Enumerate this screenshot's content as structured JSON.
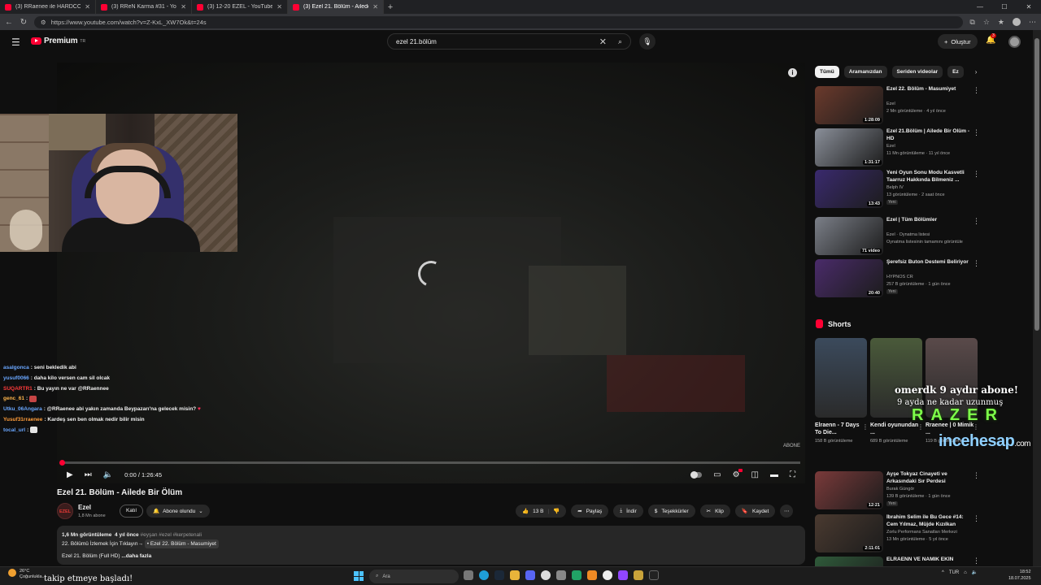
{
  "browser": {
    "tabs": [
      {
        "label": "(3) RRaenee ile HARDCORE MİNE"
      },
      {
        "label": "(3) RReN Karma #31 - YouTube"
      },
      {
        "label": "(3) 12-20 EZEL - YouTube"
      },
      {
        "label": "(3) Ezel 21. Bölüm - Ailede Bir Ölüm"
      }
    ],
    "url": "https://www.youtube.com/watch?v=Z-KxL_XW7Ok&t=24s"
  },
  "header": {
    "brand": "Premium",
    "brand_sup": "TR",
    "search_value": "ezel 21.bölüm",
    "create_label": "Oluştur",
    "notif_count": "3"
  },
  "player": {
    "time": "0:00 / 1:26:45",
    "watermark": "ABONE"
  },
  "chat": [
    {
      "user": "asalgonca",
      "color": "#6aa7ff",
      "msg": "seni bekledik abi"
    },
    {
      "user": "yusuf0066",
      "color": "#6aa7ff",
      "msg": "daha kilo versen cam sil olcak"
    },
    {
      "user": "SUQARTR1",
      "color": "#ff3b3b",
      "msg": "Bu yayın ne var @RRaennee"
    },
    {
      "user": "genc_61",
      "color": "#ffb64c",
      "msg": ""
    },
    {
      "user": "Utku_06Angara",
      "color": "#6aa7ff",
      "msg": "@RRaenee abi yakın zamanda Beypazarı'na gelecek misin?"
    },
    {
      "user": "Yusuf31rraenee",
      "color": "#ff9d3b",
      "msg": "Kardeş sen ben olmak nedir bilir misin"
    },
    {
      "user": "tocal_url",
      "color": "#6aa7ff",
      "msg": ""
    }
  ],
  "video": {
    "title": "Ezel 21. Bölüm - Ailede Bir Ölüm",
    "channel": "Ezel",
    "channel_avatar": "EZEL",
    "subscribers": "1,8 Mn abone",
    "join_label": "Katıl",
    "subscribed_label": "Abone olundu",
    "likes": "13 B",
    "share_label": "Paylaş",
    "download_label": "İndir",
    "thanks_label": "Teşekkürler",
    "clip_label": "Klip",
    "save_label": "Kaydet",
    "views": "1,6 Mn görüntüleme",
    "age": "4 yıl önce",
    "tags": "#eyşan #ezel #kerpetenali",
    "desc_line": "22. Bölümü İzlemek İçin Tıklayın→",
    "desc_link": "• Ezel 22. Bölüm - Masumiyet",
    "desc_tail": "Ezel 21. Bölüm (Full HD)",
    "more_label": "...daha fazla"
  },
  "sidebar": {
    "chips": [
      "Tümü",
      "Aramanızdan",
      "Seriden videolar",
      "Ez"
    ],
    "recommendations": [
      {
        "title": "Ezel 22. Bölüm - Masumiyet",
        "channel": "Ezel",
        "meta": "2 Mn görüntüleme · 4 yıl önce",
        "duration": "1:28:09",
        "badge": "",
        "thumb": "#6b3a2c"
      },
      {
        "title": "Ezel 21.Bölüm | Ailede Bir Ölüm - HD",
        "channel": "Ezel",
        "meta": "11 Mn görüntüleme · 11 yıl önce",
        "duration": "1:31:17",
        "badge": "",
        "thumb": "#8a8f99"
      },
      {
        "title": "Yeni Oyun Sonu Modu Kasvetli Taarruz Hakkında Bilmeniz ...",
        "channel": "Belph IV",
        "meta": "13 görüntüleme · 2 saat önce",
        "duration": "13:43",
        "badge": "Yeni",
        "thumb": "#3a2a6e"
      },
      {
        "title": "Ezel | Tüm Bölümler",
        "channel": "Ezel · Oynatma listesi",
        "meta": "Oynatma listesinin tamamını görüntüle",
        "duration": "71 video",
        "badge": "",
        "thumb": "#7b7f88"
      },
      {
        "title": "Şerefsiz Buton Destemi Beliriyor",
        "channel": "HYPNOS CR",
        "meta": "257 B görüntüleme · 1 gün önce",
        "duration": "20:40",
        "badge": "Yeni",
        "thumb": "#4a2b6a"
      }
    ],
    "shorts_title": "Shorts",
    "shorts": [
      {
        "title": "Elraenn - 7 Days To Die...",
        "views": "158 B görüntüleme",
        "thumb": "#3b4a5c"
      },
      {
        "title": "Kendi oyunundan ...",
        "views": "689 B görüntüleme",
        "thumb": "#4a5a3a"
      },
      {
        "title": "Rraenee | 0 Mimik ...",
        "views": "119 B görüntüleme",
        "thumb": "#5a4a4a"
      }
    ],
    "more_recs": [
      {
        "title": "Ayşe Tokyaz Cinayeti ve Arkasındaki Sır Perdesi",
        "channel": "Burak Güngör",
        "meta": "139 B görüntüleme · 1 gün önce",
        "duration": "12:21",
        "badge": "Yeni",
        "thumb": "#7a3a3a"
      },
      {
        "title": "İbrahim Selim ile Bu Gece #14: Cem Yılmaz, Müjde Kızılkan",
        "channel": "Zorlu Performans Sanatları Merkezi",
        "meta": "13 Mn görüntüleme · 5 yıl önce",
        "duration": "2:11:01",
        "badge": "",
        "thumb": "#4a3a30"
      },
      {
        "title": "ELRAENN VE NAMIK EKİN",
        "channel": "",
        "meta": "",
        "duration": "",
        "badge": "",
        "thumb": "#2f5a3a"
      }
    ]
  },
  "stream_overlay": {
    "gift_line1": "omerdk 9 aydır abone!",
    "gift_line2": "9 ayda ne kadar uzunmuş",
    "sponsor1": "RAZER",
    "sponsor2": "incehesap",
    "sponsor2_domain": ".com",
    "follow_msg": "takip etmeye başladı!"
  },
  "taskbar": {
    "weather_temp": "26°C",
    "weather_desc": "Çoğunlukla...",
    "search_placeholder": "Ara",
    "lang": "TUR",
    "time": "18:52",
    "date": "18.07.2025"
  }
}
